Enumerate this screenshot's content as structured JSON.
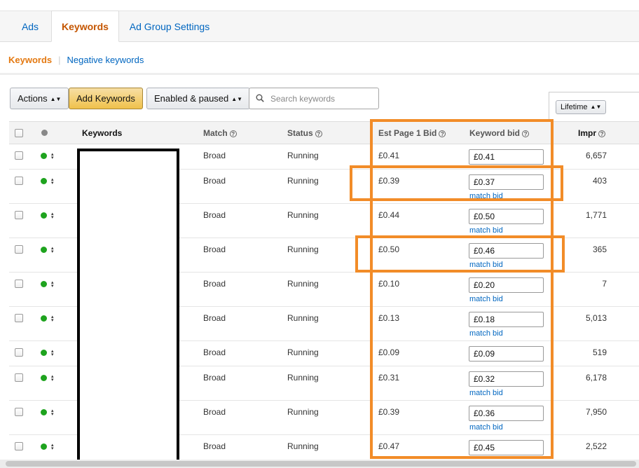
{
  "tabs": [
    {
      "label": "Ads"
    },
    {
      "label": "Keywords"
    },
    {
      "label": "Ad Group Settings"
    }
  ],
  "subnav": {
    "keywords": "Keywords",
    "negative_keywords": "Negative keywords"
  },
  "toolbar": {
    "actions": "Actions",
    "add_keywords": "Add Keywords",
    "filter": "Enabled & paused",
    "search_placeholder": "Search keywords",
    "date_range": "Lifetime"
  },
  "columns": {
    "keywords": "Keywords",
    "match": "Match",
    "status": "Status",
    "est_bid": "Est Page 1 Bid",
    "keyword_bid": "Keyword bid",
    "impr": "Impr"
  },
  "match_bid_label": "match bid",
  "rows": [
    {
      "match": "Broad",
      "status": "Running",
      "est_bid": "£0.41",
      "bid": "£0.41",
      "impr": "6,657",
      "match_bid": false
    },
    {
      "match": "Broad",
      "status": "Running",
      "est_bid": "£0.39",
      "bid": "£0.37",
      "impr": "403",
      "match_bid": true
    },
    {
      "match": "Broad",
      "status": "Running",
      "est_bid": "£0.44",
      "bid": "£0.50",
      "impr": "1,771",
      "match_bid": true
    },
    {
      "match": "Broad",
      "status": "Running",
      "est_bid": "£0.50",
      "bid": "£0.46",
      "impr": "365",
      "match_bid": true
    },
    {
      "match": "Broad",
      "status": "Running",
      "est_bid": "£0.10",
      "bid": "£0.20",
      "impr": "7",
      "match_bid": true
    },
    {
      "match": "Broad",
      "status": "Running",
      "est_bid": "£0.13",
      "bid": "£0.18",
      "impr": "5,013",
      "match_bid": true
    },
    {
      "match": "Broad",
      "status": "Running",
      "est_bid": "£0.09",
      "bid": "£0.09",
      "impr": "519",
      "match_bid": false
    },
    {
      "match": "Broad",
      "status": "Running",
      "est_bid": "£0.31",
      "bid": "£0.32",
      "impr": "6,178",
      "match_bid": true
    },
    {
      "match": "Broad",
      "status": "Running",
      "est_bid": "£0.39",
      "bid": "£0.36",
      "impr": "7,950",
      "match_bid": true
    },
    {
      "match": "Broad",
      "status": "Running",
      "est_bid": "£0.47",
      "bid": "£0.45",
      "impr": "2,522",
      "match_bid": false
    }
  ],
  "colors": {
    "accent": "#e47911",
    "link": "#0066c0",
    "highlight": "#f28c28",
    "status_dot": "#1ea31e"
  }
}
